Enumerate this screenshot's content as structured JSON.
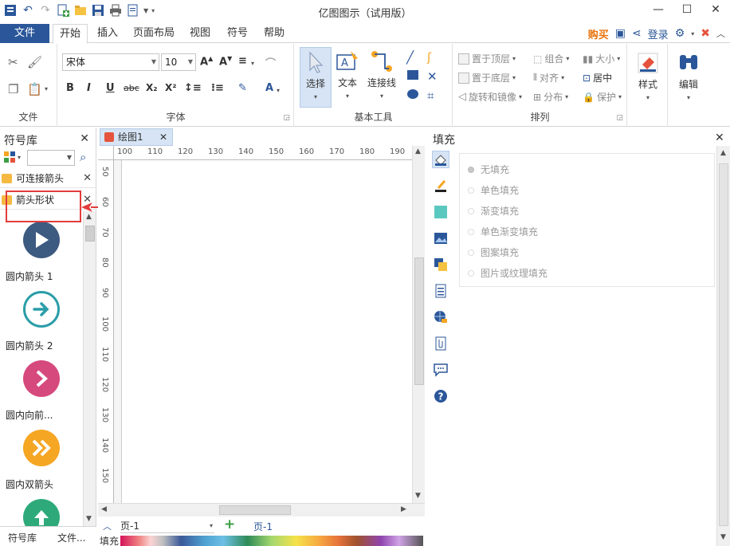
{
  "window": {
    "title": "亿图图示（试用版）"
  },
  "ribbon_tabs": {
    "file": "文件",
    "items": [
      "开始",
      "插入",
      "页面布局",
      "视图",
      "符号",
      "帮助"
    ],
    "active": "开始",
    "buy": "购买",
    "login": "登录"
  },
  "ribbon": {
    "file_group": {
      "label": "文件"
    },
    "font_group": {
      "label": "字体",
      "font_name": "宋体",
      "font_size": "10",
      "bold": "B",
      "italic": "I",
      "underline": "U",
      "strike": "abc",
      "subscript": "X₂",
      "superscript": "X²"
    },
    "tools_group": {
      "label": "基本工具",
      "select": "选择",
      "text": "文本",
      "connector": "连接线"
    },
    "arrange_group": {
      "label": "排列",
      "bring_front": "置于顶层",
      "send_back": "置于底层",
      "rotate": "旋转和镜像",
      "group": "组合",
      "align": "对齐",
      "distribute": "分布",
      "size": "大小",
      "center": "居中",
      "protect": "保护"
    },
    "style_label": "样式",
    "edit_label": "编辑"
  },
  "left_panel": {
    "title": "符号库",
    "libraries": [
      {
        "label": "可连接箭头"
      },
      {
        "label": "箭头形状"
      }
    ],
    "symbols": [
      {
        "label": "圆内箭头 1",
        "color": "#3d5a80"
      },
      {
        "label": "圆内箭头 2",
        "color": "#2a9da8"
      },
      {
        "label": "圆内向前...",
        "color": "#d6497d"
      },
      {
        "label": "圆内双箭头",
        "color": "#f5a623"
      },
      {
        "label": "",
        "color": "#2eaa7a"
      }
    ],
    "bottom_tabs": [
      "符号库",
      "文件..."
    ]
  },
  "document": {
    "tab": "绘图1",
    "ruler_h": [
      "100",
      "110",
      "120",
      "130",
      "140",
      "150",
      "160",
      "170",
      "180",
      "190"
    ],
    "ruler_v": [
      "50",
      "60",
      "70",
      "80",
      "90",
      "100",
      "110",
      "120",
      "130",
      "140",
      "150"
    ],
    "page_combo": "页-1",
    "page_link": "页-1",
    "palette_label": "填充"
  },
  "right_panel": {
    "title": "填充",
    "options": [
      {
        "label": "无填充",
        "selected": true
      },
      {
        "label": "单色填充",
        "selected": false
      },
      {
        "label": "渐变填充",
        "selected": false
      },
      {
        "label": "单色渐变填充",
        "selected": false
      },
      {
        "label": "图案填充",
        "selected": false
      },
      {
        "label": "图片或纹理填充",
        "selected": false
      }
    ]
  }
}
